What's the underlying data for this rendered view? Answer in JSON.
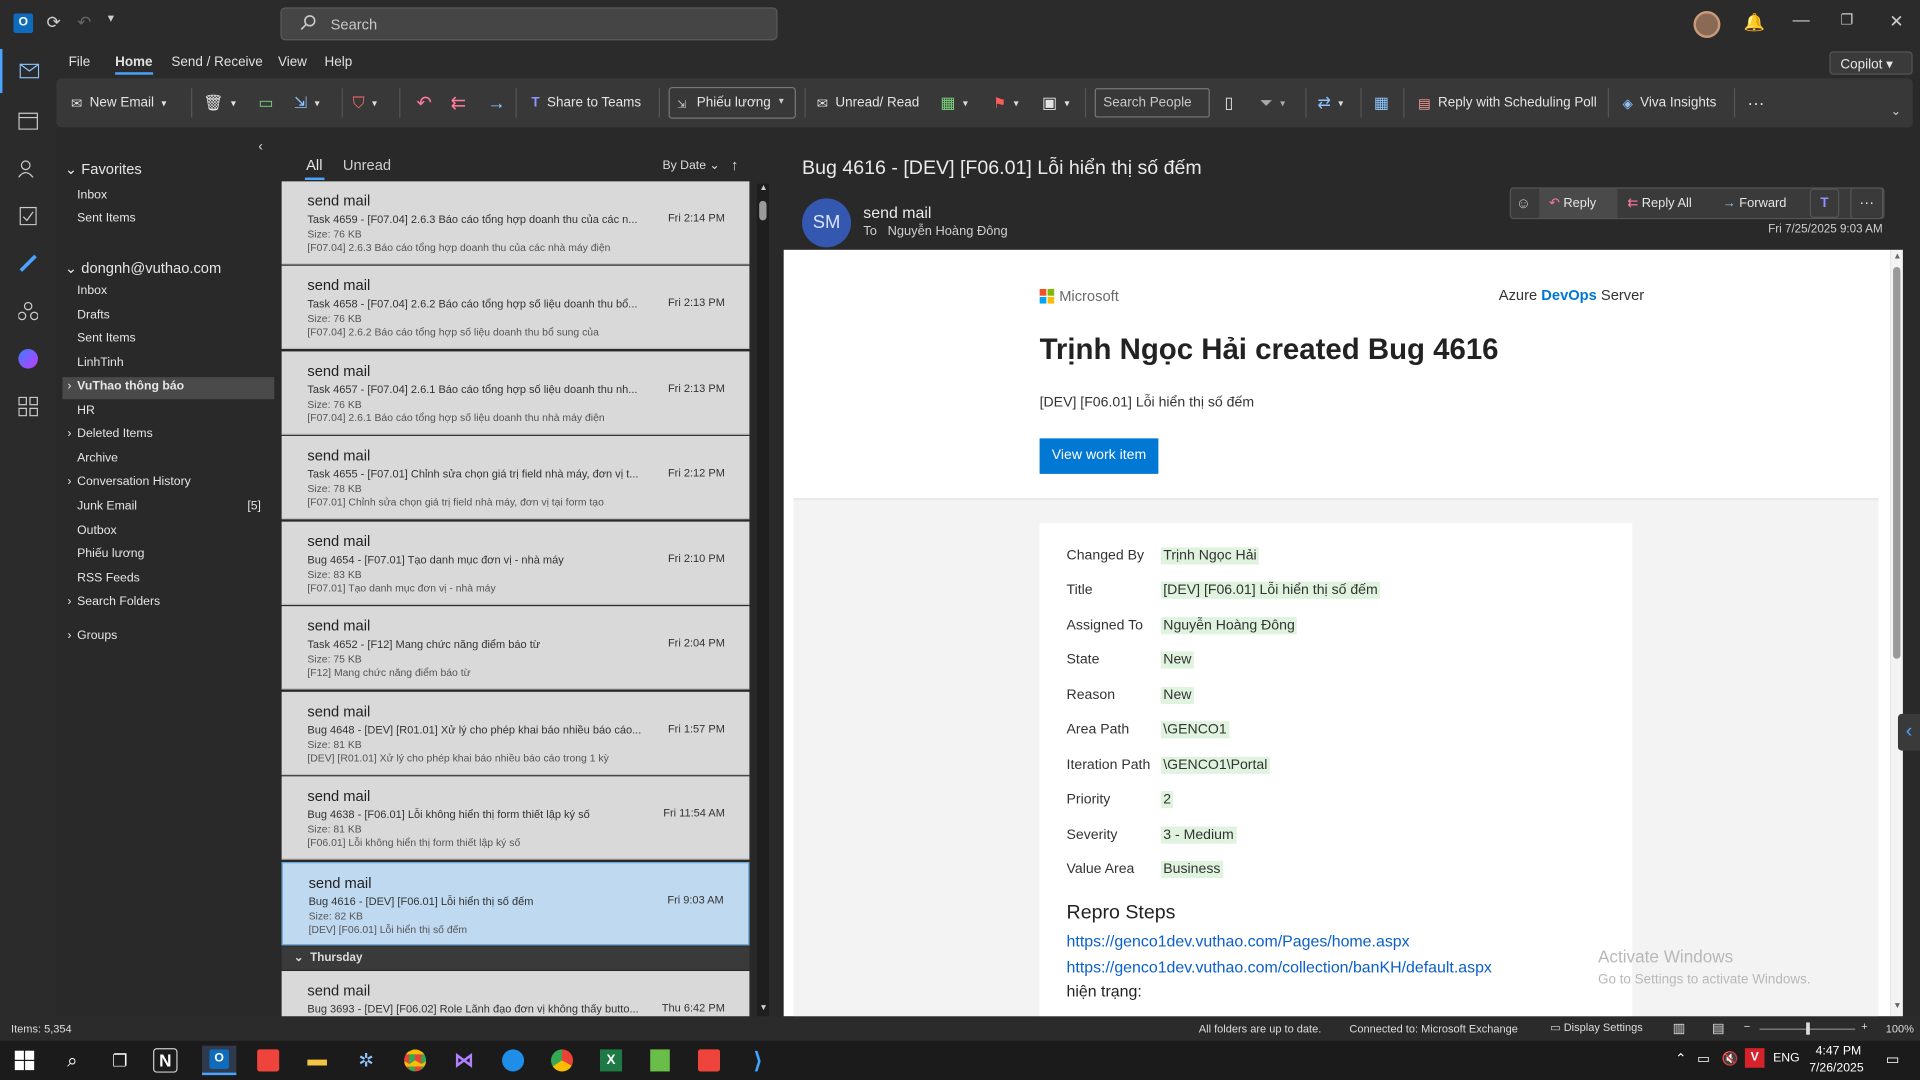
{
  "titlebar": {
    "search_placeholder": "Search",
    "copilot": "Copilot"
  },
  "menu": [
    "File",
    "Home",
    "Send / Receive",
    "View",
    "Help"
  ],
  "ribbon": {
    "new_email": "New Email",
    "share_to_teams": "Share to Teams",
    "move_folder": "Phiếu lương",
    "unread_read": "Unread/ Read",
    "search_people": "Search People",
    "reply_scheduling": "Reply with Scheduling Poll",
    "viva": "Viva Insights"
  },
  "folders": {
    "favorites": "Favorites",
    "fav_items": [
      "Inbox",
      "Sent Items"
    ],
    "account": "dongnh@vuthao.com",
    "items": [
      "Inbox",
      "Drafts",
      "Sent Items",
      "LinhTinh",
      "VuThao thông báo",
      "HR",
      "Deleted Items",
      "Archive",
      "Conversation History",
      "Junk Email",
      "Outbox",
      "Phiếu lương",
      "RSS Feeds",
      "Search Folders"
    ],
    "junk_count": "[5]",
    "groups": "Groups"
  },
  "list": {
    "tab_all": "All",
    "tab_unread": "Unread",
    "sort": "By Date",
    "messages": [
      {
        "from": "send mail",
        "subject": "Task 4659 - [F07.04] 2.6.3 Báo cáo tổng hợp doanh thu của các n...",
        "size": "Size: 76 KB",
        "preview": "[F07.04] 2.6.3 Báo cáo tổng hợp doanh thu của các nhà máy điện",
        "time": "Fri 2:14 PM"
      },
      {
        "from": "send mail",
        "subject": "Task 4658 - [F07.04] 2.6.2 Báo cáo tổng hợp số liệu doanh thu bổ...",
        "size": "Size: 76 KB",
        "preview": "[F07.04] 2.6.2 Báo cáo tổng hợp số liệu doanh thu bổ sung của",
        "time": "Fri 2:13 PM"
      },
      {
        "from": "send mail",
        "subject": "Task 4657 - [F07.04] 2.6.1 Báo cáo tổng hợp số liệu doanh thu nh...",
        "size": "Size: 76 KB",
        "preview": "[F07.04] 2.6.1 Báo cáo tổng hợp số liệu doanh thu nhà máy điện",
        "time": "Fri 2:13 PM"
      },
      {
        "from": "send mail",
        "subject": "Task 4655 - [F07.01] Chỉnh sửa chọn giá trị field nhà máy, đơn vị t...",
        "size": "Size: 78 KB",
        "preview": "[F07.01] Chỉnh sửa chọn giá trị field nhà máy, đơn vị tại form tạo",
        "time": "Fri 2:12 PM"
      },
      {
        "from": "send mail",
        "subject": "Bug 4654 - [F07.01] Tạo danh mục đơn vị - nhà máy",
        "size": "Size: 83 KB",
        "preview": "[F07.01] Tạo danh mục đơn vị - nhà máy",
        "time": "Fri 2:10 PM"
      },
      {
        "from": "send mail",
        "subject": "Task 4652 - [F12] Mang chức năng điểm báo từ",
        "size": "Size: 75 KB",
        "preview": "[F12] Mang chức năng điểm báo từ",
        "time": "Fri 2:04 PM"
      },
      {
        "from": "send mail",
        "subject": "Bug 4648 - [DEV] [R01.01] Xử lý cho phép khai báo nhiều báo cáo...",
        "size": "Size: 81 KB",
        "preview": "[DEV] [R01.01] Xử lý cho phép khai báo nhiều báo cáo trong 1 kỳ",
        "time": "Fri 1:57 PM"
      },
      {
        "from": "send mail",
        "subject": "Bug 4638 - [F06.01] Lỗi không hiển thị form thiết lập ký số",
        "size": "Size: 81 KB",
        "preview": "[F06.01] Lỗi không hiển thị form thiết lập ký số",
        "time": "Fri 11:54 AM"
      },
      {
        "from": "send mail",
        "subject": "Bug 4616 - [DEV] [F06.01] Lỗi hiển thị số đếm",
        "size": "Size: 82 KB",
        "preview": "[DEV] [F06.01] Lỗi hiển thị số đếm",
        "time": "Fri 9:03 AM"
      }
    ],
    "group_thursday": "Thursday",
    "last": {
      "from": "send mail",
      "subject": "Bug 3693 - [DEV] [F06.02] Role Lãnh đạo đơn vị không thấy butto...",
      "time": "Thu 6:42 PM"
    }
  },
  "reading": {
    "subject": "Bug 4616 - [DEV] [F06.01] Lỗi hiển thị số đếm",
    "avatar": "SM",
    "sender": "send mail",
    "to_label": "To",
    "to": "Nguyễn Hoàng Đông",
    "reply": "Reply",
    "reply_all": "Reply All",
    "forward": "Forward",
    "date": "Fri 7/25/2025 9:03 AM",
    "ms": "Microsoft",
    "azure_a": "Azure",
    "azure_b": "DevOps",
    "azure_c": "Server",
    "heading": "Trịnh Ngọc Hải created Bug 4616",
    "sub": "[DEV] [F06.01] Lỗi hiển thị số đếm",
    "view_btn": "View work item",
    "fields": [
      [
        "Changed By",
        "Trịnh Ngọc Hải"
      ],
      [
        "Title",
        "[DEV] [F06.01] Lỗi hiển thị số đếm"
      ],
      [
        "Assigned To",
        "Nguyễn Hoàng Đông"
      ],
      [
        "State",
        "New"
      ],
      [
        "Reason",
        "New"
      ],
      [
        "Area Path",
        "\\GENCO1"
      ],
      [
        "Iteration Path",
        "\\GENCO1\\Portal"
      ],
      [
        "Priority",
        "2"
      ],
      [
        "Severity",
        "3 - Medium"
      ],
      [
        "Value Area",
        "Business"
      ]
    ],
    "repro": "Repro Steps",
    "link1": "https://genco1dev.vuthao.com/Pages/home.aspx",
    "link2": "https://genco1dev.vuthao.com/collection/banKH/default.aspx",
    "hien": "hiện trạng:",
    "activate1": "Activate Windows",
    "activate2": "Go to Settings to activate Windows."
  },
  "status": {
    "items": "Items: 5,354",
    "uptodate": "All folders are up to date.",
    "connected": "Connected to: Microsoft Exchange",
    "display": "Display Settings",
    "zoom": "100%"
  },
  "taskbar": {
    "time": "4:47 PM",
    "date": "7/26/2025",
    "lang": "ENG"
  }
}
